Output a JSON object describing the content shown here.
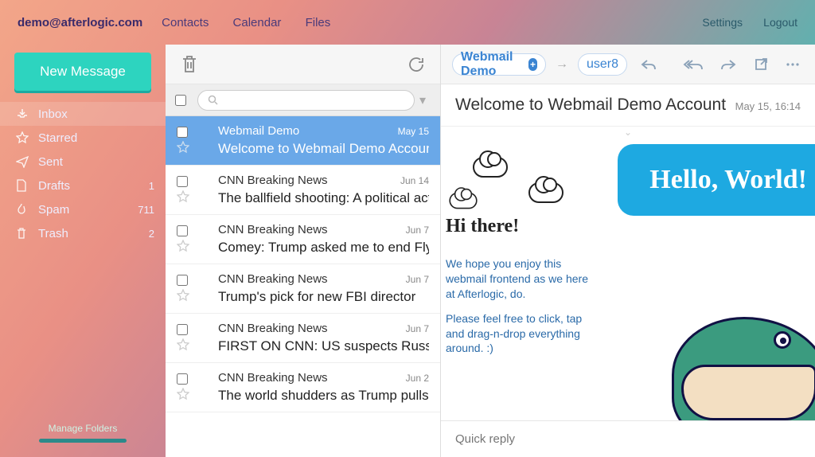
{
  "topbar": {
    "email": "demo@afterlogic.com",
    "nav": [
      "Contacts",
      "Calendar",
      "Files"
    ],
    "settings": "Settings",
    "logout": "Logout"
  },
  "sidebar": {
    "new_message": "New Message",
    "folders": [
      {
        "name": "Inbox",
        "count": ""
      },
      {
        "name": "Starred",
        "count": ""
      },
      {
        "name": "Sent",
        "count": ""
      },
      {
        "name": "Drafts",
        "count": "1"
      },
      {
        "name": "Spam",
        "count": "711"
      },
      {
        "name": "Trash",
        "count": "2"
      }
    ],
    "manage": "Manage Folders"
  },
  "search": {
    "placeholder": ""
  },
  "messages": [
    {
      "from": "Webmail Demo",
      "date": "May 15",
      "subject": "Welcome to Webmail Demo Account",
      "selected": true
    },
    {
      "from": "CNN Breaking News",
      "date": "Jun 14",
      "subject": "The ballfield shooting: A political act of v"
    },
    {
      "from": "CNN Breaking News",
      "date": "Jun 7",
      "subject": "Comey: Trump asked me to end Flynn p"
    },
    {
      "from": "CNN Breaking News",
      "date": "Jun 7",
      "subject": "Trump's pick for new FBI director"
    },
    {
      "from": "CNN Breaking News",
      "date": "Jun 7",
      "subject": "FIRST ON CNN: US suspects Russian"
    },
    {
      "from": "CNN Breaking News",
      "date": "Jun 2",
      "subject": "The world shudders as Trump pulls US"
    }
  ],
  "reader": {
    "sender": "Webmail Demo",
    "recipient": "user8",
    "subject": "Welcome to Webmail Demo Account",
    "date": "May 15, 16:14",
    "hello": "Hello, World!",
    "hi": "Hi there!",
    "p1": "We hope you enjoy this webmail frontend as we here at Afterlogic, do.",
    "p2": "Please feel free to click, tap and drag-n-drop everything around. :)",
    "quick_reply": "Quick reply"
  }
}
